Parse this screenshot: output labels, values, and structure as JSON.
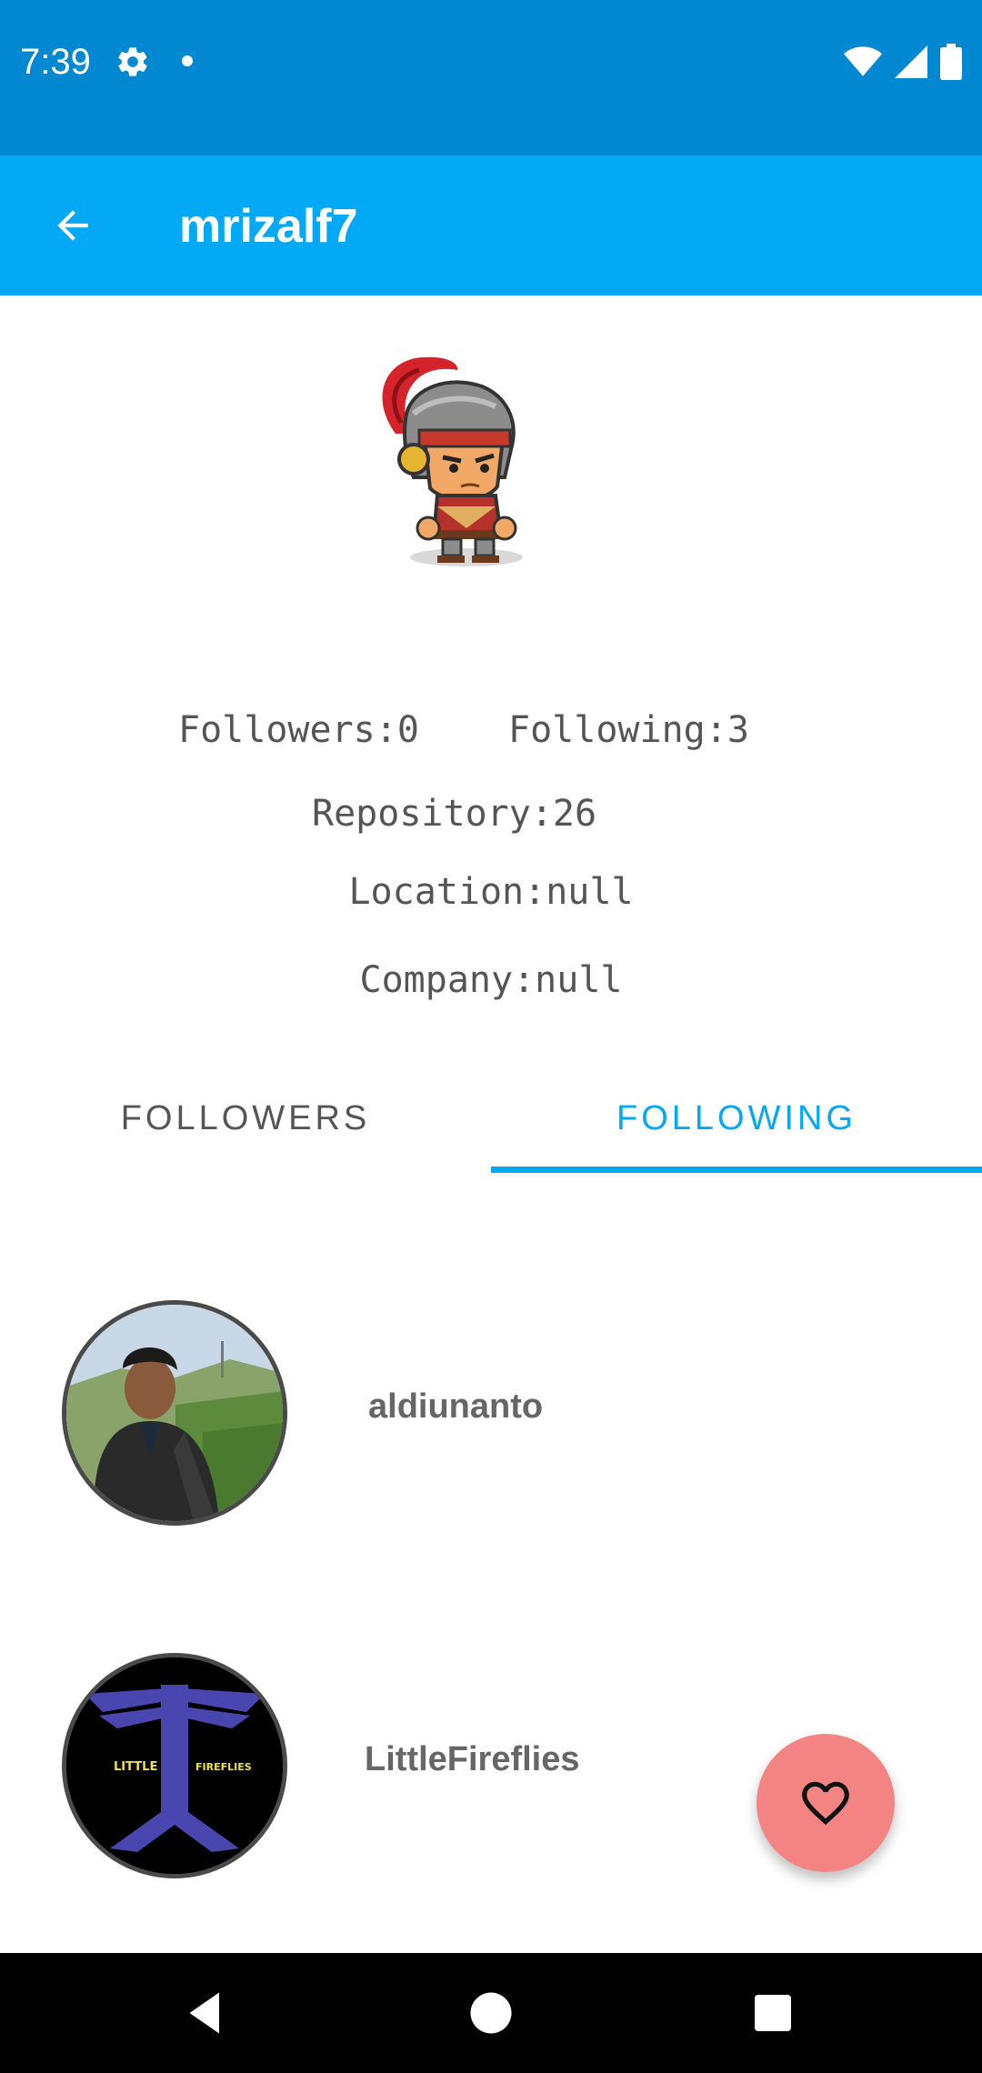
{
  "status_bar": {
    "time": "7:39",
    "icons": [
      "gear-icon",
      "notification-dot",
      "wifi-icon",
      "signal-icon",
      "battery-icon"
    ]
  },
  "app_bar": {
    "title": "mrizalf7",
    "back_icon": "arrow-back-icon",
    "background": "#03A9F4"
  },
  "profile": {
    "avatar": "knight-avatar",
    "followers": "Followers:0",
    "following": "Following:3",
    "repository": "Repository:26",
    "location": "Location:null",
    "company": "Company:null"
  },
  "tabs": {
    "items": [
      {
        "label": "FOLLOWERS",
        "selected": false
      },
      {
        "label": "FOLLOWING",
        "selected": true
      }
    ],
    "accent": "#03A9F4"
  },
  "following_list": [
    {
      "username": "aldiunanto",
      "avatar": "photo-avatar"
    },
    {
      "username": "LittleFireflies",
      "avatar": "logo-avatar",
      "logo_text_left": "LITTLE",
      "logo_text_right": "FIREFLIES"
    }
  ],
  "fab": {
    "icon": "heart-outline-icon",
    "color": "#F48484"
  },
  "nav_bar": {
    "buttons": [
      "back-triangle-icon",
      "home-circle-icon",
      "recents-square-icon"
    ]
  },
  "colors": {
    "status_bar": "#0288D1",
    "text_gray": "#555555"
  }
}
